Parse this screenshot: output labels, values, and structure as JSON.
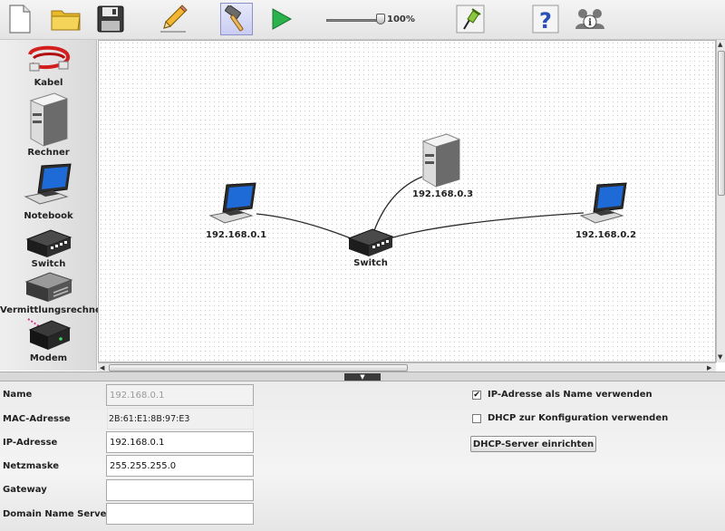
{
  "toolbar": {
    "zoom_value": "100%",
    "zoom_fraction": 1.0,
    "buttons": [
      "new-file-icon",
      "open-folder-icon",
      "save-icon",
      "edit-pencil-icon",
      "hammer-icon",
      "play-icon",
      "pin-icon",
      "help-icon",
      "info-users-icon"
    ]
  },
  "sidebar": {
    "items": [
      {
        "label": "Kabel",
        "icon": "cable-icon"
      },
      {
        "label": "Rechner",
        "icon": "server-icon"
      },
      {
        "label": "Notebook",
        "icon": "notebook-icon"
      },
      {
        "label": "Switch",
        "icon": "switch-icon"
      },
      {
        "label": "Vermittlungsrechner",
        "icon": "router-icon"
      },
      {
        "label": "Modem",
        "icon": "modem-icon"
      }
    ]
  },
  "canvas": {
    "nodes": [
      {
        "label": "192.168.0.1",
        "type": "notebook"
      },
      {
        "label": "192.168.0.3",
        "type": "server"
      },
      {
        "label": "192.168.0.2",
        "type": "notebook"
      },
      {
        "label": "Switch",
        "type": "switch"
      }
    ]
  },
  "props": {
    "name_label": "Name",
    "name_value": "192.168.0.1",
    "mac_label": "MAC-Adresse",
    "mac_value": "2B:61:E1:8B:97:E3",
    "ip_label": "IP-Adresse",
    "ip_value": "192.168.0.1",
    "mask_label": "Netzmaske",
    "mask_value": "255.255.255.0",
    "gateway_label": "Gateway",
    "gateway_value": "",
    "dns_label": "Domain Name Server",
    "dns_value": "",
    "use_ip_as_name_label": "IP-Adresse als Name verwenden",
    "use_ip_as_name_checked": true,
    "use_dhcp_label": "DHCP zur Konfiguration verwenden",
    "use_dhcp_checked": false,
    "dhcp_button_label": "DHCP-Server einrichten"
  },
  "colors": {
    "toolbar_active": "#c9cdf2",
    "play_green": "#2bb24c",
    "cable_red": "#d41f1f",
    "notebook_screen": "#1e6ad6"
  }
}
